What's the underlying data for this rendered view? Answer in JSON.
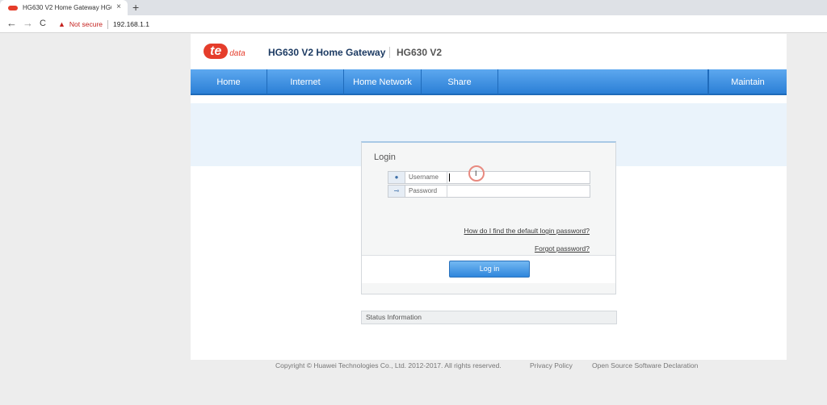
{
  "browser": {
    "tab_title": "HG630 V2 Home Gateway HG630",
    "tab_close": "×",
    "new_tab": "+",
    "back": "←",
    "forward": "→",
    "reload": "C",
    "security_label": "Not secure",
    "url": "192.168.1.1"
  },
  "header": {
    "logo_text": "te",
    "logo_sub": "data",
    "product_name": "HG630 V2 Home Gateway",
    "model": "HG630 V2"
  },
  "menu": {
    "home": "Home",
    "internet": "Internet",
    "home_network": "Home Network",
    "share": "Share",
    "maintain": "Maintain"
  },
  "login": {
    "title": "Login",
    "username_label": "Username",
    "password_label": "Password",
    "username_value": "",
    "password_value": "",
    "help_link": "How do I find the default login password?",
    "forgot_link": "Forgot password?",
    "button": "Log in"
  },
  "status": {
    "label": "Status Information"
  },
  "footer": {
    "copyright": "Copyright © Huawei Technologies Co., Ltd. 2012-2017. All rights reserved.",
    "privacy": "Privacy Policy",
    "open_source": "Open Source Software Declaration"
  },
  "colors": {
    "menu_blue": "#2b7fd6",
    "brand_red": "#e53d2b",
    "title_navy": "#1d3b63"
  }
}
